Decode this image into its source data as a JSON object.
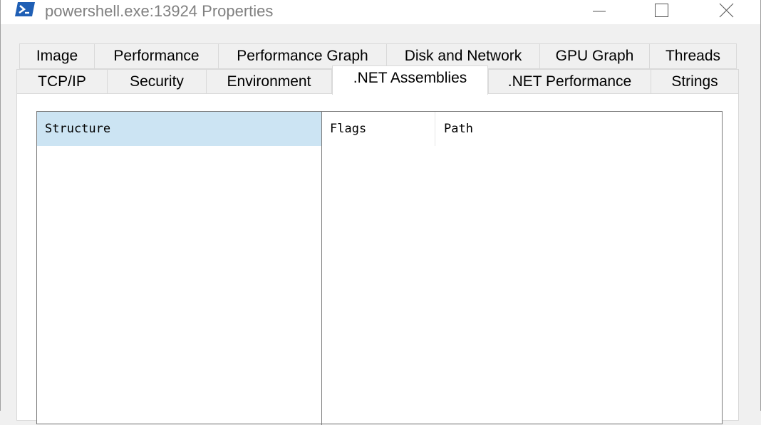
{
  "window": {
    "title": "powershell.exe:13924 Properties",
    "accent": "#0078d7",
    "icon": "powershell-icon"
  },
  "caption_buttons": {
    "minimize_icon": "minimize-icon",
    "maximize_icon": "maximize-icon",
    "close_icon": "close-icon"
  },
  "tabs": {
    "row1": [
      "Image",
      "Performance",
      "Performance Graph",
      "Disk and Network",
      "GPU Graph",
      "Threads"
    ],
    "row2": [
      "TCP/IP",
      "Security",
      "Environment",
      ".NET Assemblies",
      ".NET Performance",
      "Strings"
    ],
    "active": ".NET Assemblies"
  },
  "assemblies": {
    "tree_header": "Structure",
    "columns": [
      "Flags",
      "Path"
    ],
    "header_highlight": "#cce4f3",
    "rows": []
  }
}
